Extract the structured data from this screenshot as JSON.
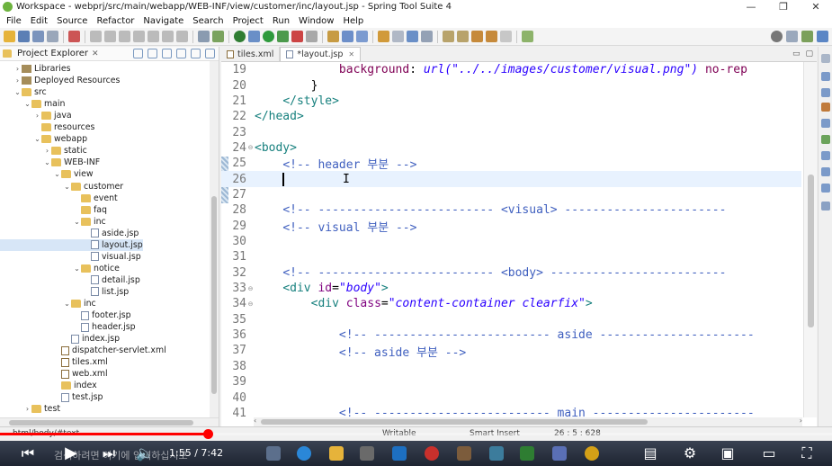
{
  "window": {
    "title": "Workspace - webprj/src/main/webapp/WEB-INF/view/customer/inc/layout.jsp - Spring Tool Suite 4",
    "controls": [
      "—",
      "❐",
      "✕"
    ]
  },
  "menu": [
    "File",
    "Edit",
    "Source",
    "Refactor",
    "Navigate",
    "Search",
    "Project",
    "Run",
    "Window",
    "Help"
  ],
  "explorer": {
    "title": "Project Explorer",
    "tree": [
      {
        "label": "Libraries",
        "icon": "lib",
        "chev": "›",
        "indent": 1
      },
      {
        "label": "Deployed Resources",
        "icon": "lib",
        "chev": "›",
        "indent": 1
      },
      {
        "label": "src",
        "icon": "folder",
        "chev": "⌄",
        "indent": 1
      },
      {
        "label": "main",
        "icon": "folder",
        "chev": "⌄",
        "indent": 2
      },
      {
        "label": "java",
        "icon": "folder",
        "chev": "›",
        "indent": 3
      },
      {
        "label": "resources",
        "icon": "folder",
        "chev": "",
        "indent": 3
      },
      {
        "label": "webapp",
        "icon": "folder",
        "chev": "⌄",
        "indent": 3
      },
      {
        "label": "static",
        "icon": "folder",
        "chev": "›",
        "indent": 4
      },
      {
        "label": "WEB-INF",
        "icon": "folder",
        "chev": "⌄",
        "indent": 4
      },
      {
        "label": "view",
        "icon": "folder",
        "chev": "⌄",
        "indent": 5
      },
      {
        "label": "customer",
        "icon": "folder",
        "chev": "⌄",
        "indent": 6
      },
      {
        "label": "event",
        "icon": "folder",
        "chev": "",
        "indent": 7
      },
      {
        "label": "faq",
        "icon": "folder",
        "chev": "",
        "indent": 7
      },
      {
        "label": "inc",
        "icon": "folder",
        "chev": "⌄",
        "indent": 7
      },
      {
        "label": "aside.jsp",
        "icon": "file",
        "chev": "",
        "indent": 8
      },
      {
        "label": "layout.jsp",
        "icon": "file",
        "chev": "",
        "indent": 8,
        "selected": true
      },
      {
        "label": "visual.jsp",
        "icon": "file",
        "chev": "",
        "indent": 8
      },
      {
        "label": "notice",
        "icon": "folder",
        "chev": "⌄",
        "indent": 7
      },
      {
        "label": "detail.jsp",
        "icon": "file",
        "chev": "",
        "indent": 8
      },
      {
        "label": "list.jsp",
        "icon": "file",
        "chev": "",
        "indent": 8
      },
      {
        "label": "inc",
        "icon": "folder",
        "chev": "⌄",
        "indent": 6
      },
      {
        "label": "footer.jsp",
        "icon": "file",
        "chev": "",
        "indent": 7
      },
      {
        "label": "header.jsp",
        "icon": "file",
        "chev": "",
        "indent": 7
      },
      {
        "label": "index.jsp",
        "icon": "file",
        "chev": "",
        "indent": 6
      },
      {
        "label": "dispatcher-servlet.xml",
        "icon": "xml",
        "chev": "",
        "indent": 5
      },
      {
        "label": "tiles.xml",
        "icon": "xml",
        "chev": "",
        "indent": 5
      },
      {
        "label": "web.xml",
        "icon": "xml",
        "chev": "",
        "indent": 5
      },
      {
        "label": "index",
        "icon": "folder",
        "chev": "",
        "indent": 5
      },
      {
        "label": "test.jsp",
        "icon": "file",
        "chev": "",
        "indent": 5
      },
      {
        "label": "test",
        "icon": "folder",
        "chev": "›",
        "indent": 2
      }
    ]
  },
  "editor": {
    "tabs": [
      {
        "label": "tiles.xml",
        "active": false
      },
      {
        "label": "*layout.jsp",
        "active": true
      }
    ],
    "lines": [
      {
        "no": "19",
        "fold": "",
        "tokens": [
          [
            "plain",
            "            "
          ],
          [
            "css",
            "background"
          ],
          [
            "plain",
            ": "
          ],
          [
            "val",
            "url(\"../../images/customer/visual.png\")"
          ],
          [
            "plain",
            " "
          ],
          [
            "css",
            "no-rep"
          ]
        ]
      },
      {
        "no": "20",
        "fold": "",
        "tokens": [
          [
            "plain",
            "        }"
          ]
        ]
      },
      {
        "no": "21",
        "fold": "",
        "tokens": [
          [
            "plain",
            "    "
          ],
          [
            "tag",
            "</style>"
          ]
        ]
      },
      {
        "no": "22",
        "fold": "",
        "tokens": [
          [
            "tag",
            "</head>"
          ]
        ]
      },
      {
        "no": "23",
        "fold": "",
        "tokens": []
      },
      {
        "no": "24",
        "fold": "⊖",
        "tokens": [
          [
            "tag",
            "<body>"
          ]
        ]
      },
      {
        "no": "25",
        "fold": "",
        "tokens": [
          [
            "plain",
            "    "
          ],
          [
            "cmt",
            "<!-- header 부분 -->"
          ]
        ]
      },
      {
        "no": "26",
        "fold": "",
        "tokens": [
          [
            "plain",
            "    "
          ],
          [
            "caret",
            ""
          ]
        ],
        "current": true
      },
      {
        "no": "27",
        "fold": "",
        "tokens": []
      },
      {
        "no": "28",
        "fold": "",
        "tokens": [
          [
            "plain",
            "    "
          ],
          [
            "cmt",
            "<!-- ------------------------- <visual> -----------------------"
          ]
        ]
      },
      {
        "no": "29",
        "fold": "",
        "tokens": [
          [
            "plain",
            "    "
          ],
          [
            "cmt",
            "<!-- visual 부분 -->"
          ]
        ]
      },
      {
        "no": "30",
        "fold": "",
        "tokens": []
      },
      {
        "no": "31",
        "fold": "",
        "tokens": []
      },
      {
        "no": "32",
        "fold": "",
        "tokens": [
          [
            "plain",
            "    "
          ],
          [
            "cmt",
            "<!-- ------------------------- <body> -------------------------"
          ]
        ]
      },
      {
        "no": "33",
        "fold": "⊖",
        "tokens": [
          [
            "plain",
            "    "
          ],
          [
            "tag",
            "<div "
          ],
          [
            "attr",
            "id"
          ],
          [
            "plain",
            "="
          ],
          [
            "val",
            "\"body\""
          ],
          [
            "tag",
            ">"
          ]
        ]
      },
      {
        "no": "34",
        "fold": "⊖",
        "tokens": [
          [
            "plain",
            "        "
          ],
          [
            "tag",
            "<div "
          ],
          [
            "attr",
            "class"
          ],
          [
            "plain",
            "="
          ],
          [
            "val",
            "\"content-container clearfix\""
          ],
          [
            "tag",
            ">"
          ]
        ]
      },
      {
        "no": "35",
        "fold": "",
        "tokens": []
      },
      {
        "no": "36",
        "fold": "",
        "tokens": [
          [
            "plain",
            "            "
          ],
          [
            "cmt",
            "<!-- ------------------------- aside ----------------------"
          ]
        ]
      },
      {
        "no": "37",
        "fold": "",
        "tokens": [
          [
            "plain",
            "            "
          ],
          [
            "cmt",
            "<!-- aside 부분 -->"
          ]
        ]
      },
      {
        "no": "38",
        "fold": "",
        "tokens": []
      },
      {
        "no": "39",
        "fold": "",
        "tokens": []
      },
      {
        "no": "40",
        "fold": "",
        "tokens": []
      },
      {
        "no": "41",
        "fold": "",
        "tokens": [
          [
            "plain",
            "            "
          ],
          [
            "cmt",
            "<!-- ------------------------- main -----------------------"
          ]
        ]
      }
    ]
  },
  "status": {
    "path": "html/body/#text",
    "writable": "Writable",
    "insert_mode": "Smart Insert",
    "position": "26 : 5 : 628"
  },
  "player": {
    "time": "1:55 / 7:42",
    "caption": "검색하려면 여기에 입력하십시오",
    "progress": 0.25
  },
  "colors": {
    "tag": "#17807e",
    "comment": "#3f5fbf",
    "attr": "#7f007f",
    "value": "#2a00ff",
    "css_keyword": "#7f0055",
    "progress_red": "#ff0000"
  }
}
